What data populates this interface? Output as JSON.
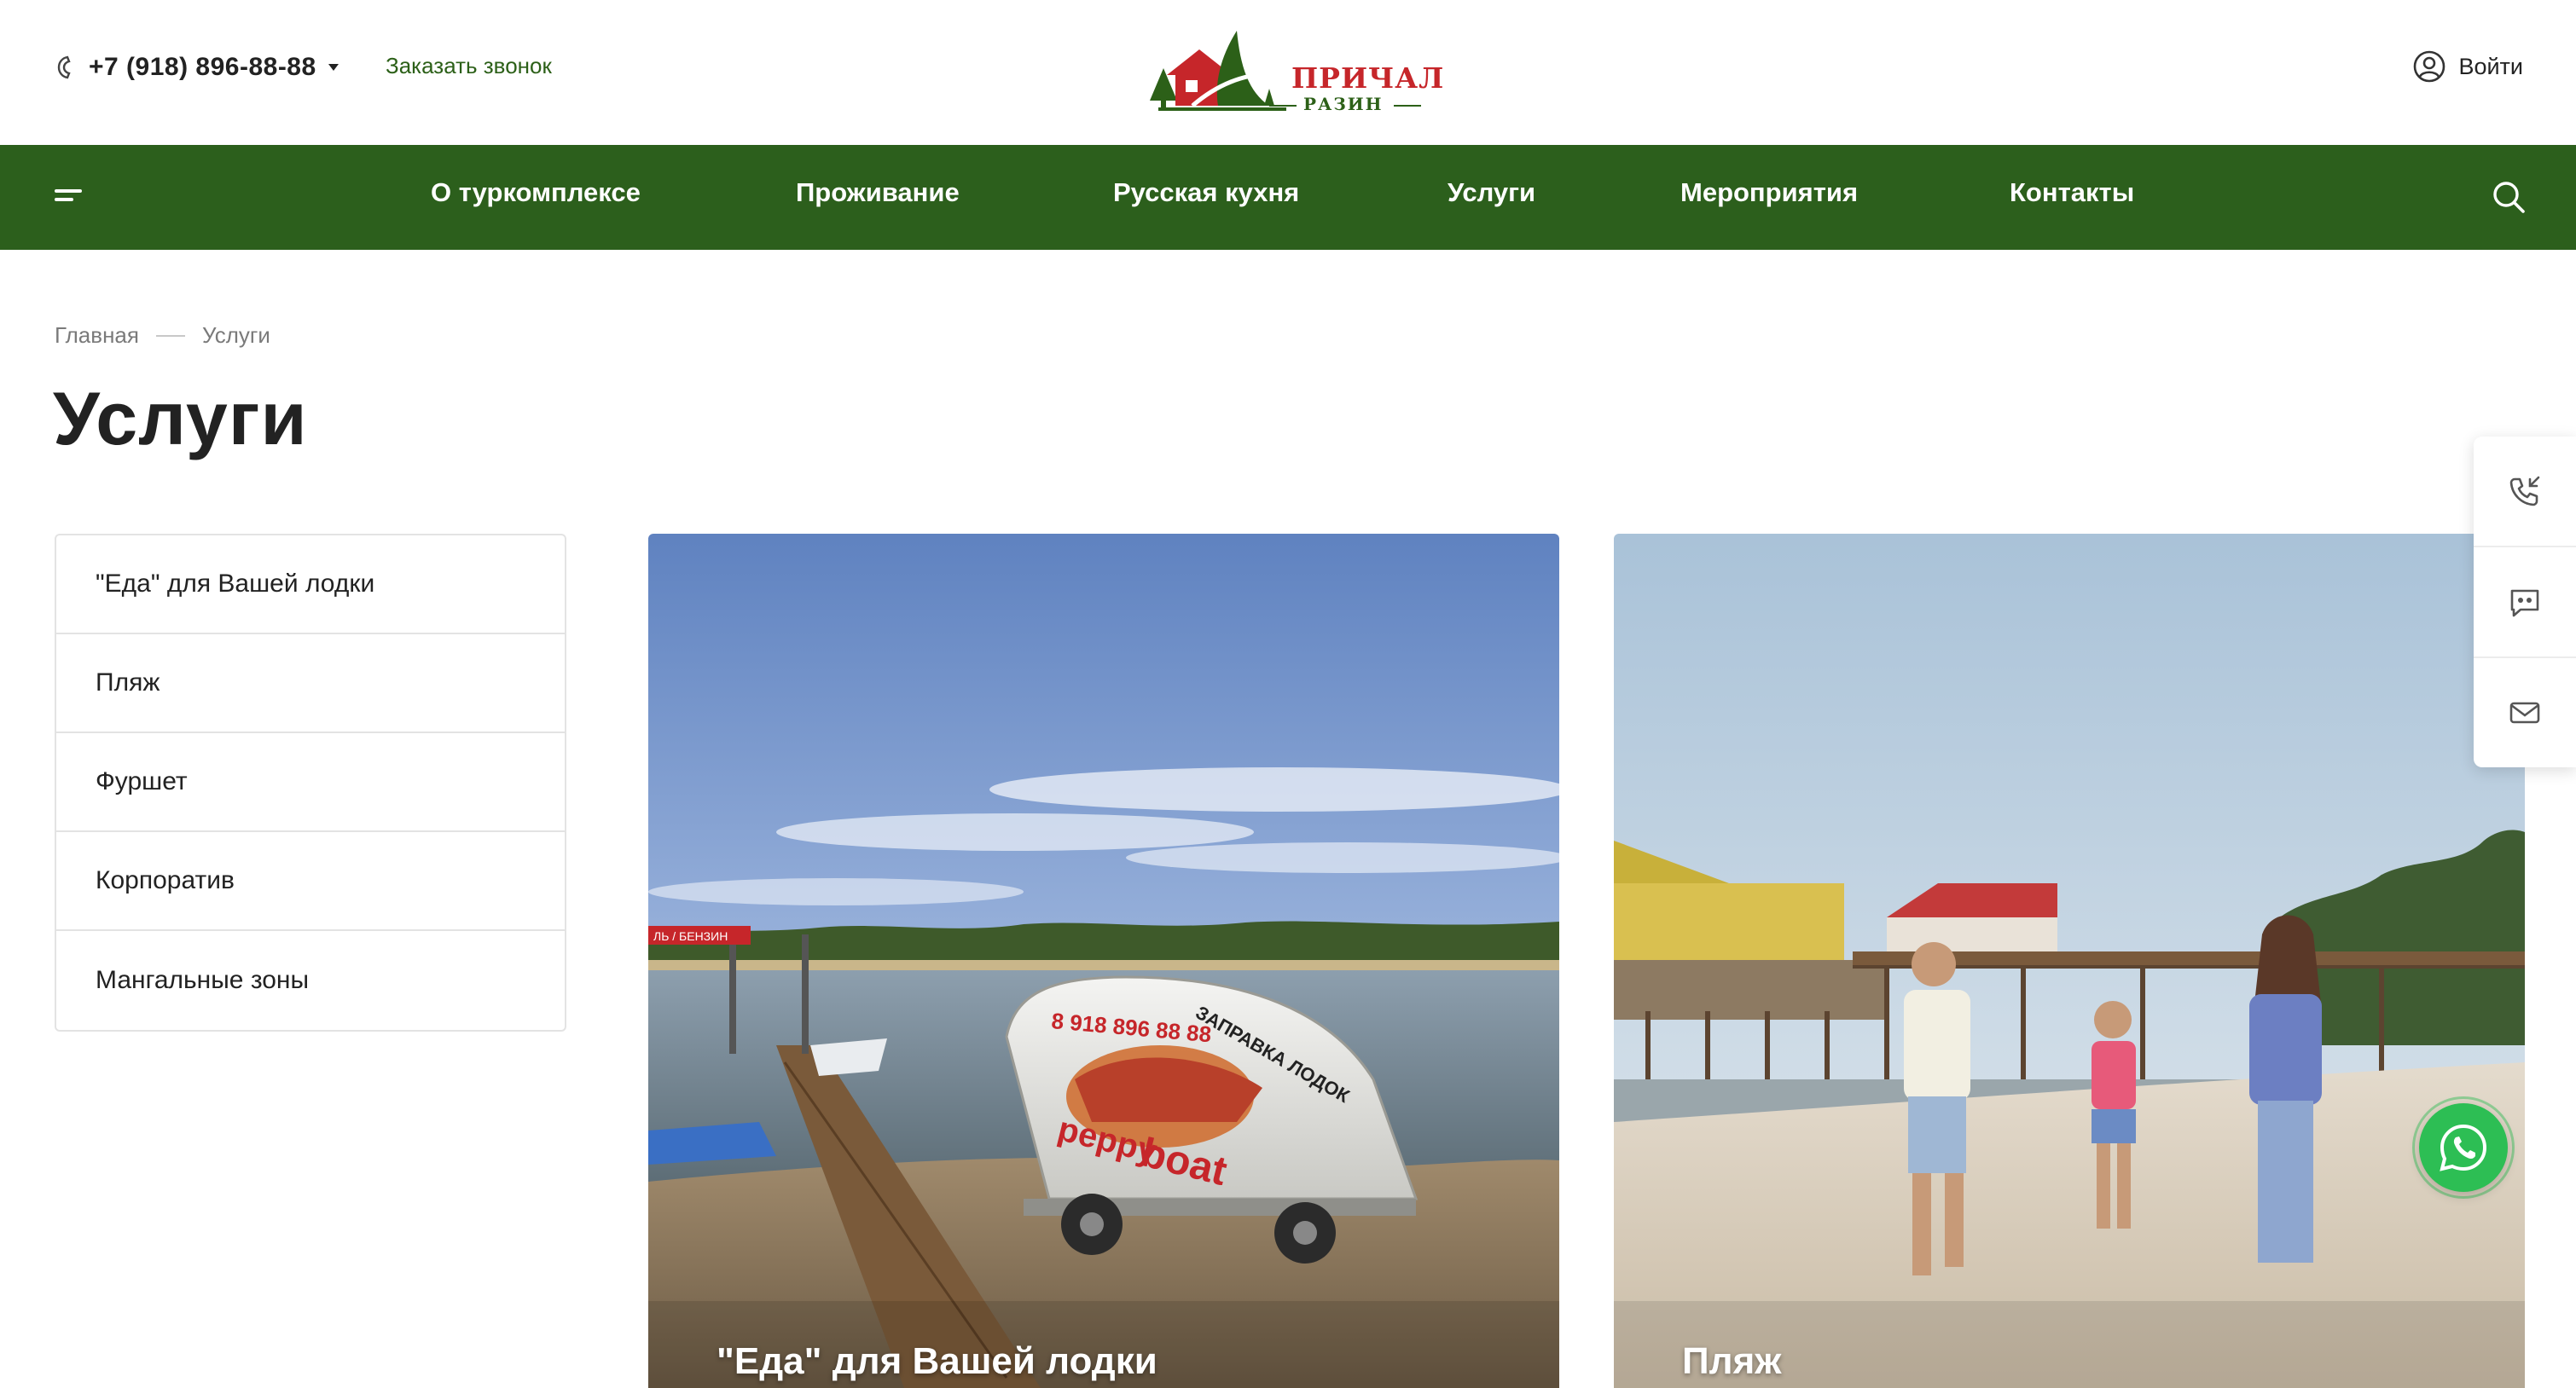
{
  "header": {
    "phone": "+7 (918) 896-88-88",
    "callback_label": "Заказать звонок",
    "logo_title": "ПРИЧАЛ",
    "logo_subtitle": "РАЗИН",
    "login_label": "Войти"
  },
  "nav": {
    "items": [
      {
        "label": "О туркомплексе"
      },
      {
        "label": "Проживание"
      },
      {
        "label": "Русская кухня"
      },
      {
        "label": "Услуги"
      },
      {
        "label": "Мероприятия"
      },
      {
        "label": "Контакты"
      }
    ]
  },
  "breadcrumbs": [
    {
      "label": "Главная"
    },
    {
      "label": "Услуги"
    }
  ],
  "page_title": "Услуги",
  "sidebar": {
    "items": [
      {
        "label": "\"Еда\" для Вашей лодки"
      },
      {
        "label": "Пляж"
      },
      {
        "label": "Фуршет"
      },
      {
        "label": "Корпоратив"
      },
      {
        "label": "Мангальные зоны"
      }
    ]
  },
  "cards": [
    {
      "title": "\"Еда\" для Вашей лодки",
      "image_text": [
        "8 918 896 88 88",
        "ЗАПРАВКА ЛОДОК",
        "peppy",
        "boat",
        "ЛЬ / БЕНЗИН"
      ]
    },
    {
      "title": "Пляж"
    }
  ],
  "colors": {
    "brand_green": "#2c5f1c",
    "brand_red": "#c6262a",
    "whatsapp_green": "#2dbe54"
  },
  "icons": {
    "phone": "phone-icon",
    "login": "user-circle-icon",
    "menu": "hamburger-icon",
    "search": "search-icon",
    "callback": "phone-callback-icon",
    "chat": "chat-icon",
    "mail": "mail-icon",
    "whatsapp": "whatsapp-icon"
  }
}
